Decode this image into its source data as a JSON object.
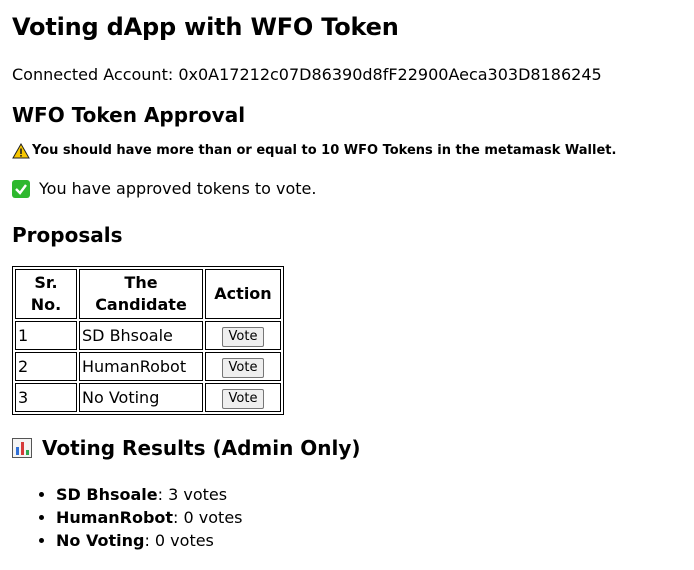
{
  "title": "Voting dApp with WFO Token",
  "account": {
    "label": "Connected Account:",
    "address": "0x0A17212c07D86390d8fF22900Aeca303D8186245"
  },
  "approval": {
    "heading": "WFO Token Approval",
    "warning_icon": "warning-icon",
    "warning": "You should have more than or equal to 10 WFO Tokens in the metamask Wallet.",
    "approved_icon": "check-mark-icon",
    "approved_text": "You have approved tokens to vote."
  },
  "proposals": {
    "heading": "Proposals",
    "columns": [
      "Sr. No.",
      "The Candidate",
      "Action"
    ],
    "rows": [
      {
        "no": "1",
        "candidate": "SD Bhsoale",
        "action": "Vote"
      },
      {
        "no": "2",
        "candidate": "HumanRobot",
        "action": "Vote"
      },
      {
        "no": "3",
        "candidate": "No Voting",
        "action": "Vote"
      }
    ]
  },
  "results": {
    "icon": "bar-chart-icon",
    "heading": "Voting Results (Admin Only)",
    "items": [
      {
        "name": "SD Bhsoale",
        "votes": ": 3 votes"
      },
      {
        "name": "HumanRobot",
        "votes": ": 0 votes"
      },
      {
        "name": "No Voting",
        "votes": ": 0 votes"
      }
    ]
  }
}
